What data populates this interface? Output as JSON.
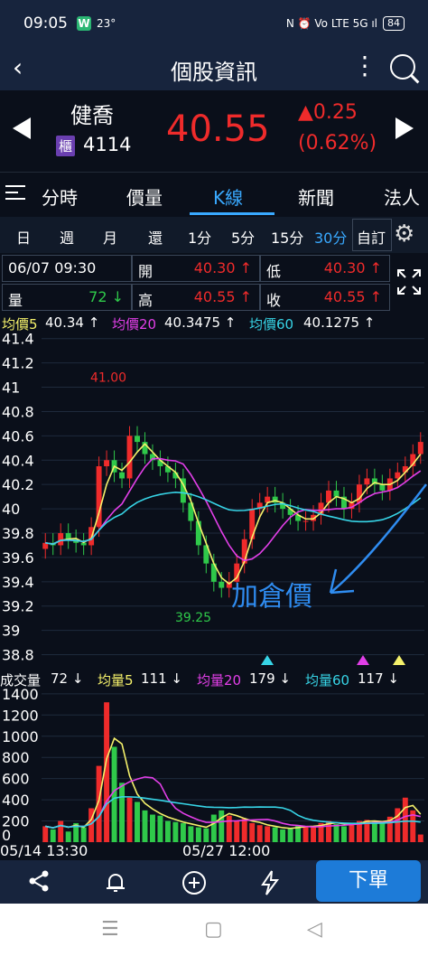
{
  "status": {
    "time": "09:05",
    "app_badge": "W",
    "temp": "23°",
    "right": "N ⏰ Vo LTE 5G ıl",
    "battery": "84"
  },
  "titlebar": {
    "title": "個股資訊"
  },
  "stock": {
    "name": "健喬",
    "market": "櫃",
    "code": "4114",
    "price": "40.55",
    "change": "▲0.25",
    "change_pct": "(0.62%)"
  },
  "tabs": [
    "分時",
    "價量",
    "K線",
    "新聞",
    "法人"
  ],
  "periods": [
    "日",
    "週",
    "月",
    "還",
    "1分",
    "5分",
    "15分",
    "30分",
    "自訂"
  ],
  "info": {
    "datetime": "06/07 09:30",
    "open_label": "開",
    "open": "40.30 ↑",
    "low_label": "低",
    "low": "40.30 ↑",
    "vol_label": "量",
    "vol": "72 ↓",
    "high_label": "高",
    "high": "40.55 ↑",
    "close_label": "收",
    "close": "40.55 ↑"
  },
  "ma": {
    "ma5_label": "均價5",
    "ma5": "40.34 ↑",
    "ma20_label": "均價20",
    "ma20": "40.3475 ↑",
    "ma60_label": "均價60",
    "ma60": "40.1275 ↑"
  },
  "volume_row": {
    "label": "成交量",
    "value": "72 ↓",
    "v5_label": "均量5",
    "v5": "111 ↓",
    "v20_label": "均量20",
    "v20": "179 ↓",
    "v60_label": "均量60",
    "v60": "117 ↓"
  },
  "chart_data": {
    "type": "candlestick",
    "y_ticks": [
      "41.4",
      "41.2",
      "41",
      "40.8",
      "40.6",
      "40.4",
      "40.2",
      "40",
      "39.8",
      "39.6",
      "39.4",
      "39.2",
      "39",
      "38.8"
    ],
    "ylim": [
      38.7,
      41.45
    ],
    "annotations": {
      "high": "41.00",
      "low": "39.25",
      "note": "加倉價"
    },
    "vol_ticks": [
      "1400",
      "1200",
      "1000",
      "800",
      "600",
      "400",
      "200",
      "0"
    ],
    "vol_lim": [
      0,
      1450
    ],
    "close": [
      39.72,
      39.7,
      39.8,
      39.75,
      39.72,
      39.7,
      39.85,
      40.35,
      40.4,
      40.3,
      40.25,
      40.6,
      40.55,
      40.45,
      40.4,
      40.35,
      40.3,
      40.25,
      40.05,
      39.9,
      39.7,
      39.55,
      39.4,
      39.35,
      39.4,
      39.55,
      39.75,
      40.0,
      40.05,
      40.1,
      40.05,
      40.0,
      39.95,
      39.9,
      39.9,
      39.95,
      40.05,
      40.15,
      40.1,
      40.0,
      40.05,
      40.2,
      40.25,
      40.2,
      40.15,
      40.25,
      40.3,
      40.35,
      40.45,
      40.55
    ],
    "high_marks": [
      41.0
    ],
    "volume": [
      150,
      120,
      200,
      100,
      180,
      140,
      320,
      720,
      1320,
      900,
      560,
      420,
      380,
      300,
      260,
      250,
      200,
      190,
      180,
      150,
      140,
      130,
      260,
      300,
      250,
      200,
      220,
      180,
      160,
      150,
      140,
      120,
      130,
      160,
      150,
      140,
      180,
      200,
      170,
      150,
      180,
      200,
      210,
      190,
      180,
      240,
      320,
      420,
      300,
      72
    ],
    "colors": {
      "up": "#ef2b2b",
      "down": "#2fc94a",
      "ma5": "#f5f16b",
      "ma20": "#e23fe8",
      "ma60": "#37d4e6"
    }
  },
  "dates": {
    "left": "05/14 13:30",
    "mid": "05/27 12:00"
  },
  "bottom": {
    "order": "下單"
  }
}
